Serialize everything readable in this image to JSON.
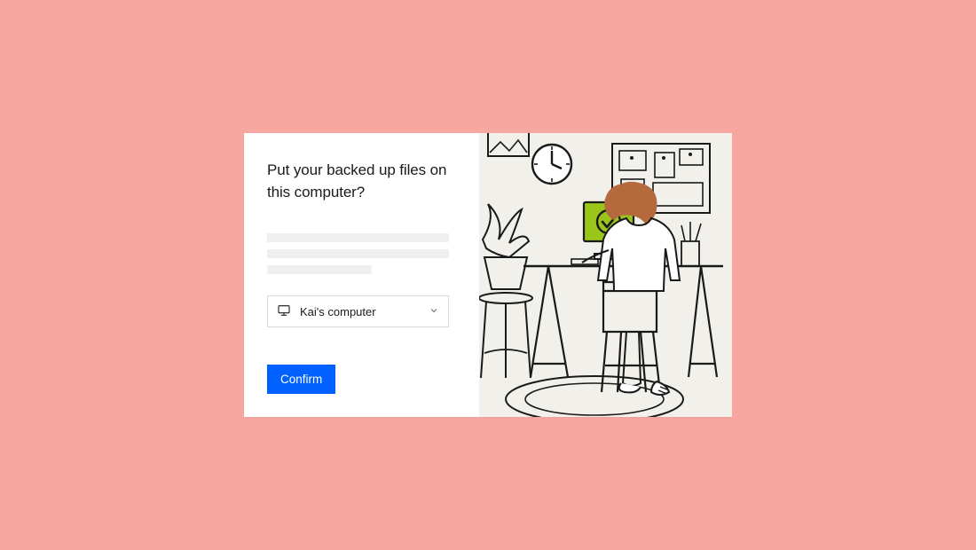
{
  "dialog": {
    "title": "Put your backed up files on this computer?"
  },
  "select": {
    "selected_label": "Kai's computer"
  },
  "actions": {
    "confirm_label": "Confirm"
  },
  "illustration": {
    "alt": "Person sitting at a desk looking at a monitor with a green checkmark; clock, plant, pinboard, chair, rug in a line-art style",
    "accent_color": "#9ac61c",
    "hair_color": "#b46a3d"
  }
}
